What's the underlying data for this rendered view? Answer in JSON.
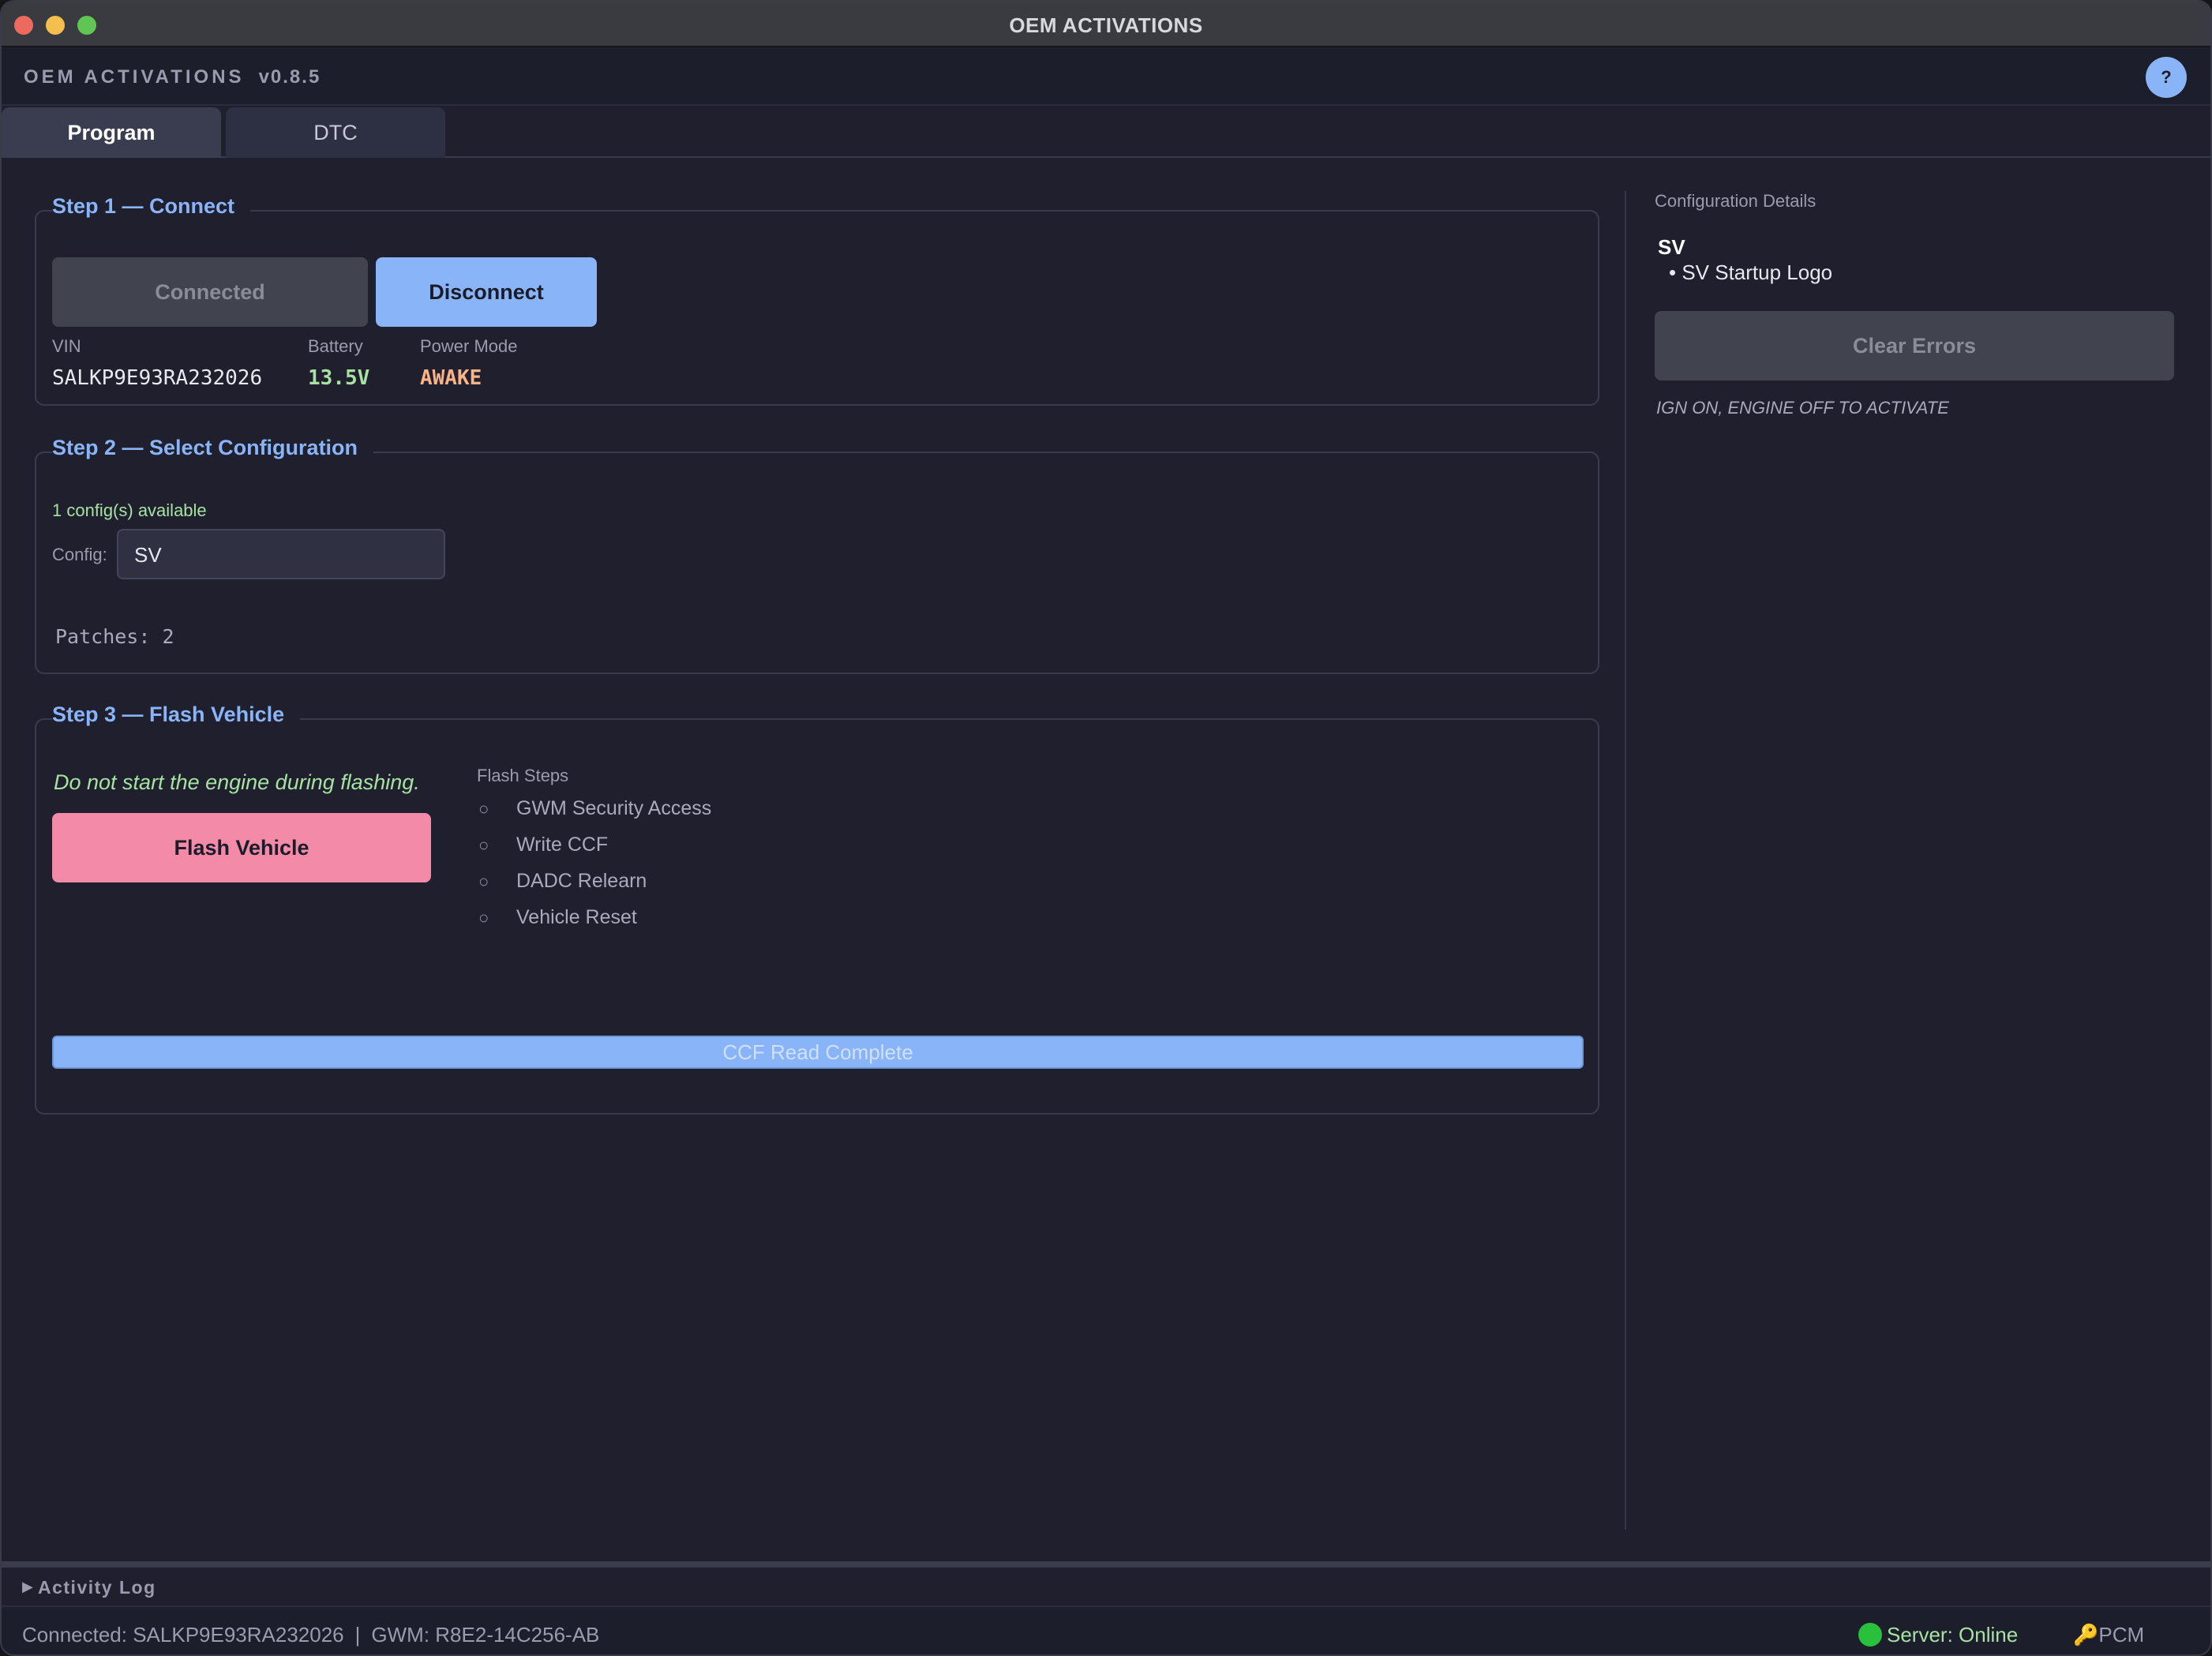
{
  "window": {
    "title": "OEM ACTIVATIONS"
  },
  "app": {
    "name": "OEM ACTIVATIONS",
    "version": "v0.8.5",
    "help_label": "?"
  },
  "tabs": [
    {
      "label": "Program",
      "active": true
    },
    {
      "label": "DTC",
      "active": false
    }
  ],
  "step1": {
    "title": "Step 1 — Connect",
    "connected_label": "Connected",
    "disconnect_label": "Disconnect",
    "vin_label": "VIN",
    "vin_value": "SALKP9E93RA232026",
    "battery_label": "Battery",
    "battery_value": "13.5V",
    "power_mode_label": "Power Mode",
    "power_mode_value": "AWAKE"
  },
  "step2": {
    "title": "Step 2 — Select Configuration",
    "available": "1 config(s) available",
    "config_label": "Config:",
    "config_value": "SV",
    "patches": "Patches: 2"
  },
  "step3": {
    "title": "Step 3 — Flash Vehicle",
    "warning": "Do not start the engine during flashing.",
    "flash_label": "Flash Vehicle",
    "steps_title": "Flash Steps",
    "steps": [
      {
        "bullet": "○",
        "label": "GWM Security Access"
      },
      {
        "bullet": "○",
        "label": "Write CCF"
      },
      {
        "bullet": "○",
        "label": "DADC Relearn"
      },
      {
        "bullet": "○",
        "label": "Vehicle Reset"
      }
    ],
    "progress_text": "CCF Read Complete",
    "progress_fraction": 1.0
  },
  "config_details": {
    "title": "Configuration Details",
    "config_name": "SV",
    "items": [
      "• SV Startup Logo"
    ],
    "clear_errors_label": "Clear Errors",
    "note": "IGN ON, ENGINE OFF TO ACTIVATE"
  },
  "activity_log": {
    "label": "Activity Log",
    "expanded": false
  },
  "status": {
    "connected": "Connected: SALKP9E93RA232026",
    "separator": "|",
    "gwm": "GWM: R8E2-14C256-AB",
    "server": "Server: Online",
    "pcm": "PCM",
    "pcm_icon": "🔑"
  },
  "colors": {
    "accent": "#8ab4f8",
    "flash": "#f38ba8",
    "success": "#a6e3a1",
    "warning": "#fab387",
    "background": "#1f1f2e"
  }
}
